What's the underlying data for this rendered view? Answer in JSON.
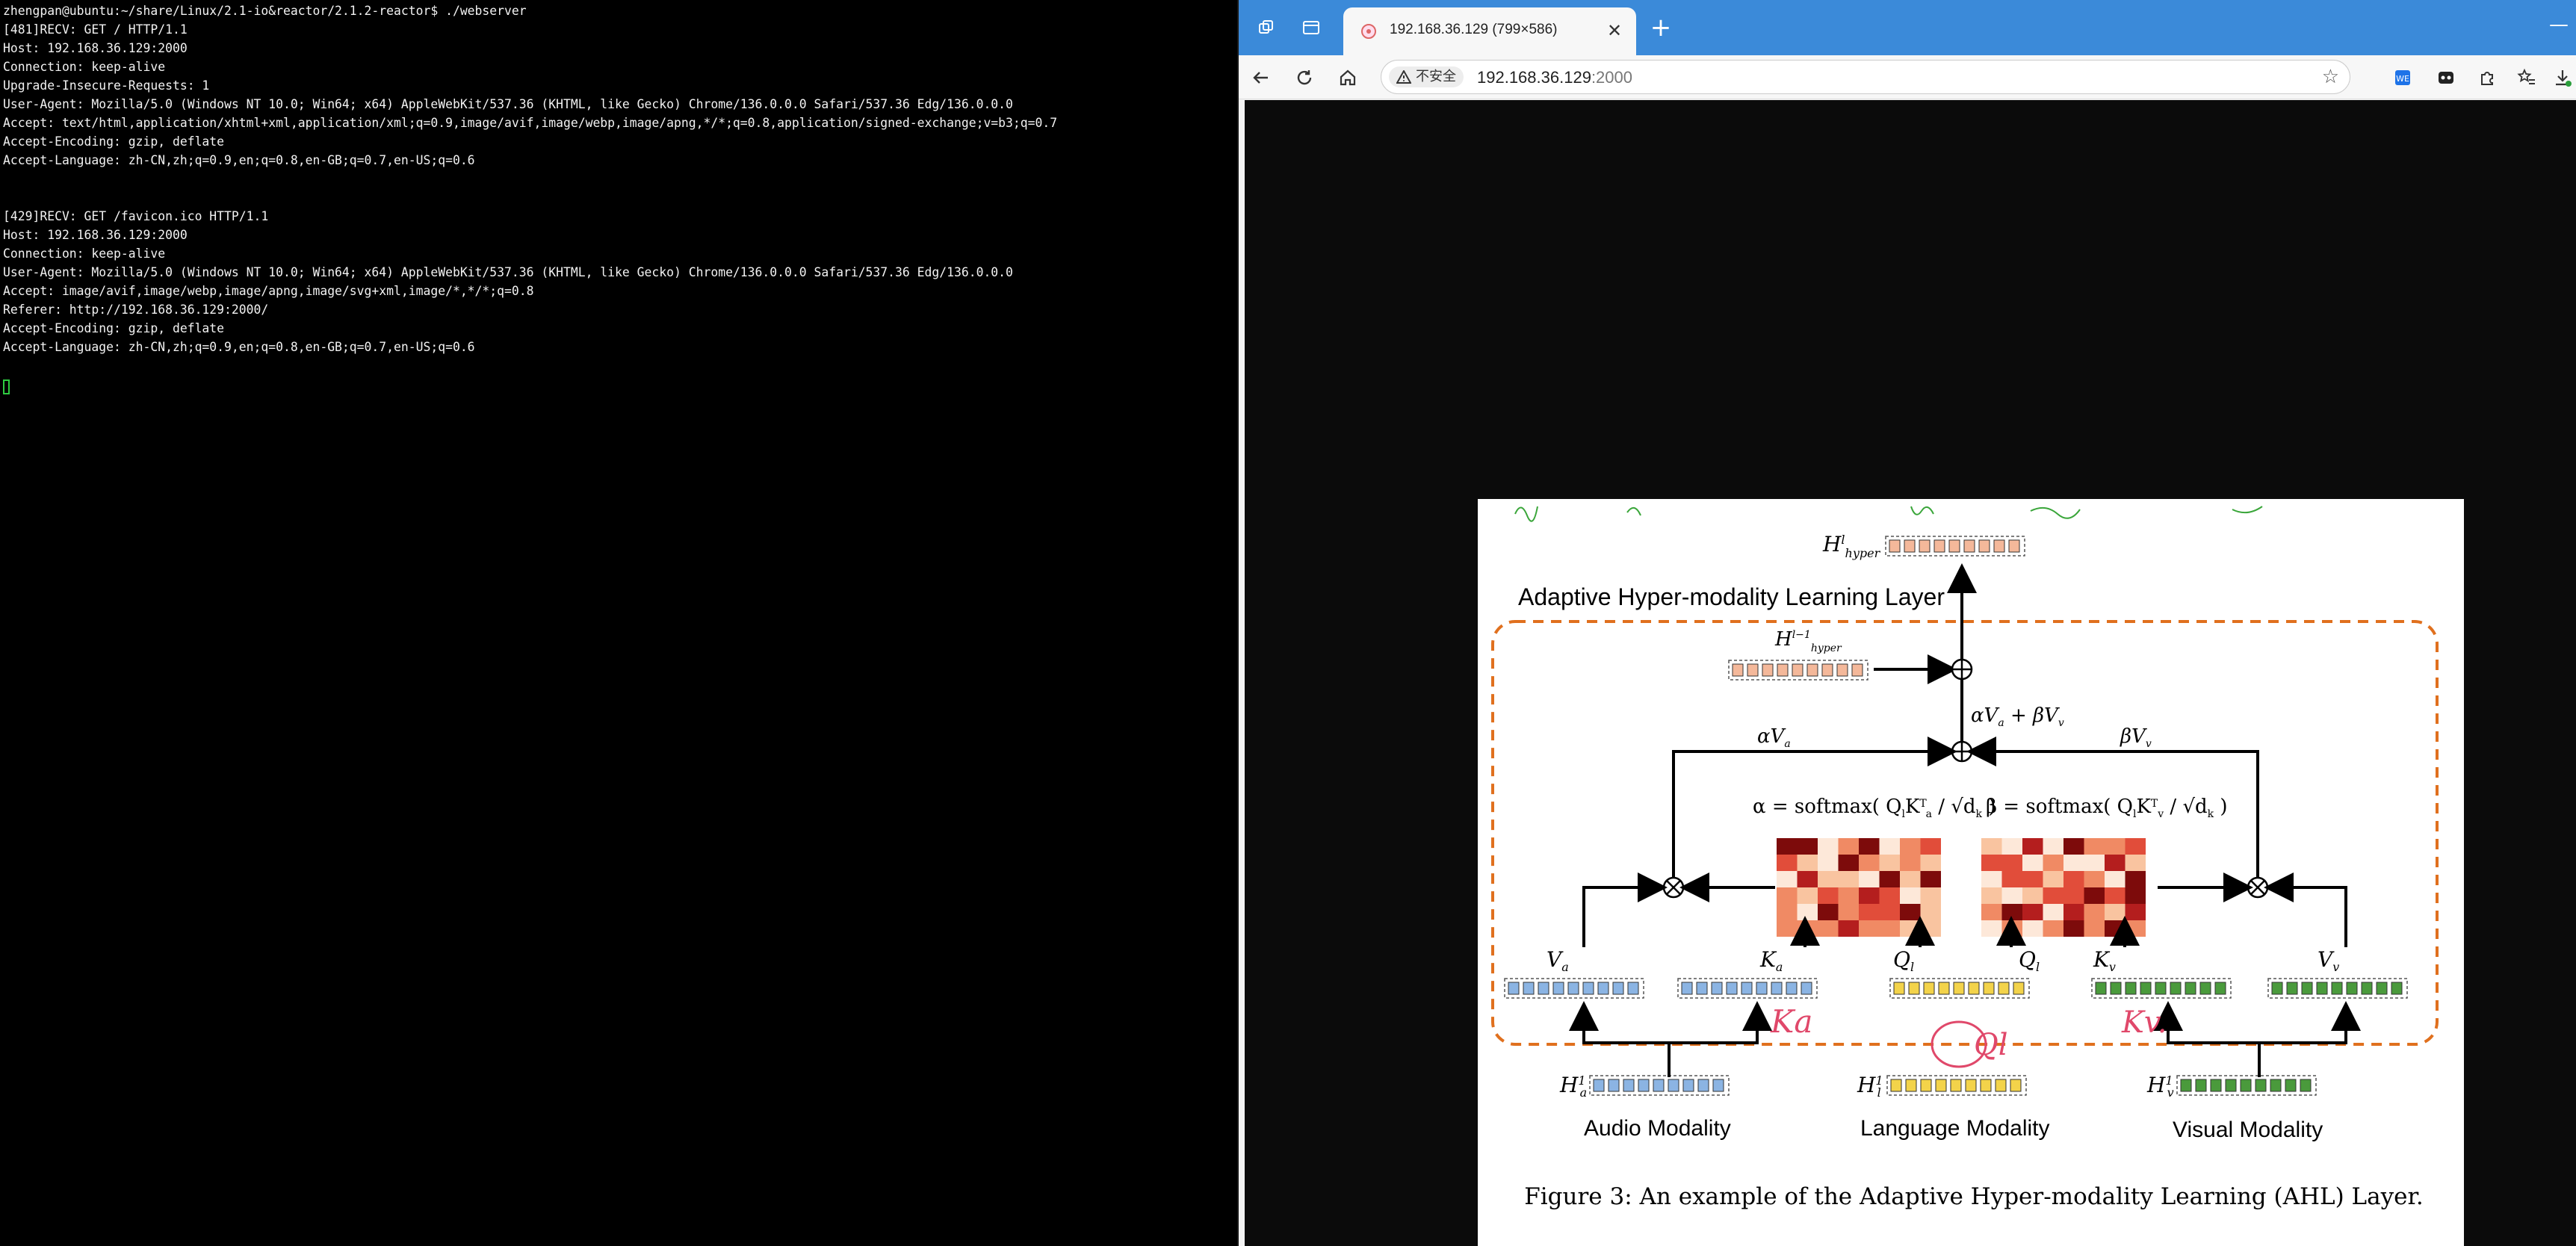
{
  "terminal": {
    "lines": [
      "zhengpan@ubuntu:~/share/Linux/2.1-io&reactor/2.1.2-reactor$ ./webserver",
      "[481]RECV: GET / HTTP/1.1",
      "Host: 192.168.36.129:2000",
      "Connection: keep-alive",
      "Upgrade-Insecure-Requests: 1",
      "User-Agent: Mozilla/5.0 (Windows NT 10.0; Win64; x64) AppleWebKit/537.36 (KHTML, like Gecko) Chrome/136.0.0.0 Safari/537.36 Edg/136.0.0.0",
      "Accept: text/html,application/xhtml+xml,application/xml;q=0.9,image/avif,image/webp,image/apng,*/*;q=0.8,application/signed-exchange;v=b3;q=0.7",
      "Accept-Encoding: gzip, deflate",
      "Accept-Language: zh-CN,zh;q=0.9,en;q=0.8,en-GB;q=0.7,en-US;q=0.6",
      "",
      "",
      "[429]RECV: GET /favicon.ico HTTP/1.1",
      "Host: 192.168.36.129:2000",
      "Connection: keep-alive",
      "User-Agent: Mozilla/5.0 (Windows NT 10.0; Win64; x64) AppleWebKit/537.36 (KHTML, like Gecko) Chrome/136.0.0.0 Safari/537.36 Edg/136.0.0.0",
      "Accept: image/avif,image/webp,image/apng,image/svg+xml,image/*,*/*;q=0.8",
      "Referer: http://192.168.36.129:2000/",
      "Accept-Encoding: gzip, deflate",
      "Accept-Language: zh-CN,zh;q=0.9,en;q=0.8,en-GB;q=0.7,en-US;q=0.6"
    ]
  },
  "browser": {
    "tab_title": "192.168.36.129 (799×586)",
    "security_label": "不安全",
    "url_host": "192.168.36.129",
    "url_port": ":2000",
    "accent_color": "#3b8ad9"
  },
  "figure": {
    "layer_title": "Adaptive Hyper-modality Learning Layer",
    "caption": "Figure 3: An example of the Adaptive Hyper-modality Learning (AHL) Layer.",
    "modalities": {
      "audio": "Audio Modality",
      "language": "Language Modality",
      "visual": "Visual Modality"
    },
    "labels": {
      "h_hyper_l": "H",
      "alpha_va": "αV",
      "beta_vv": "βV",
      "sum_label": "αV",
      "alpha_eq": "α = softmax",
      "beta_eq": "β = softmax",
      "va": "V",
      "ka": "K",
      "ql": "Q",
      "kv": "K",
      "vv": "V"
    },
    "handwritten": [
      "Ka",
      "Ql",
      "Kv."
    ]
  }
}
